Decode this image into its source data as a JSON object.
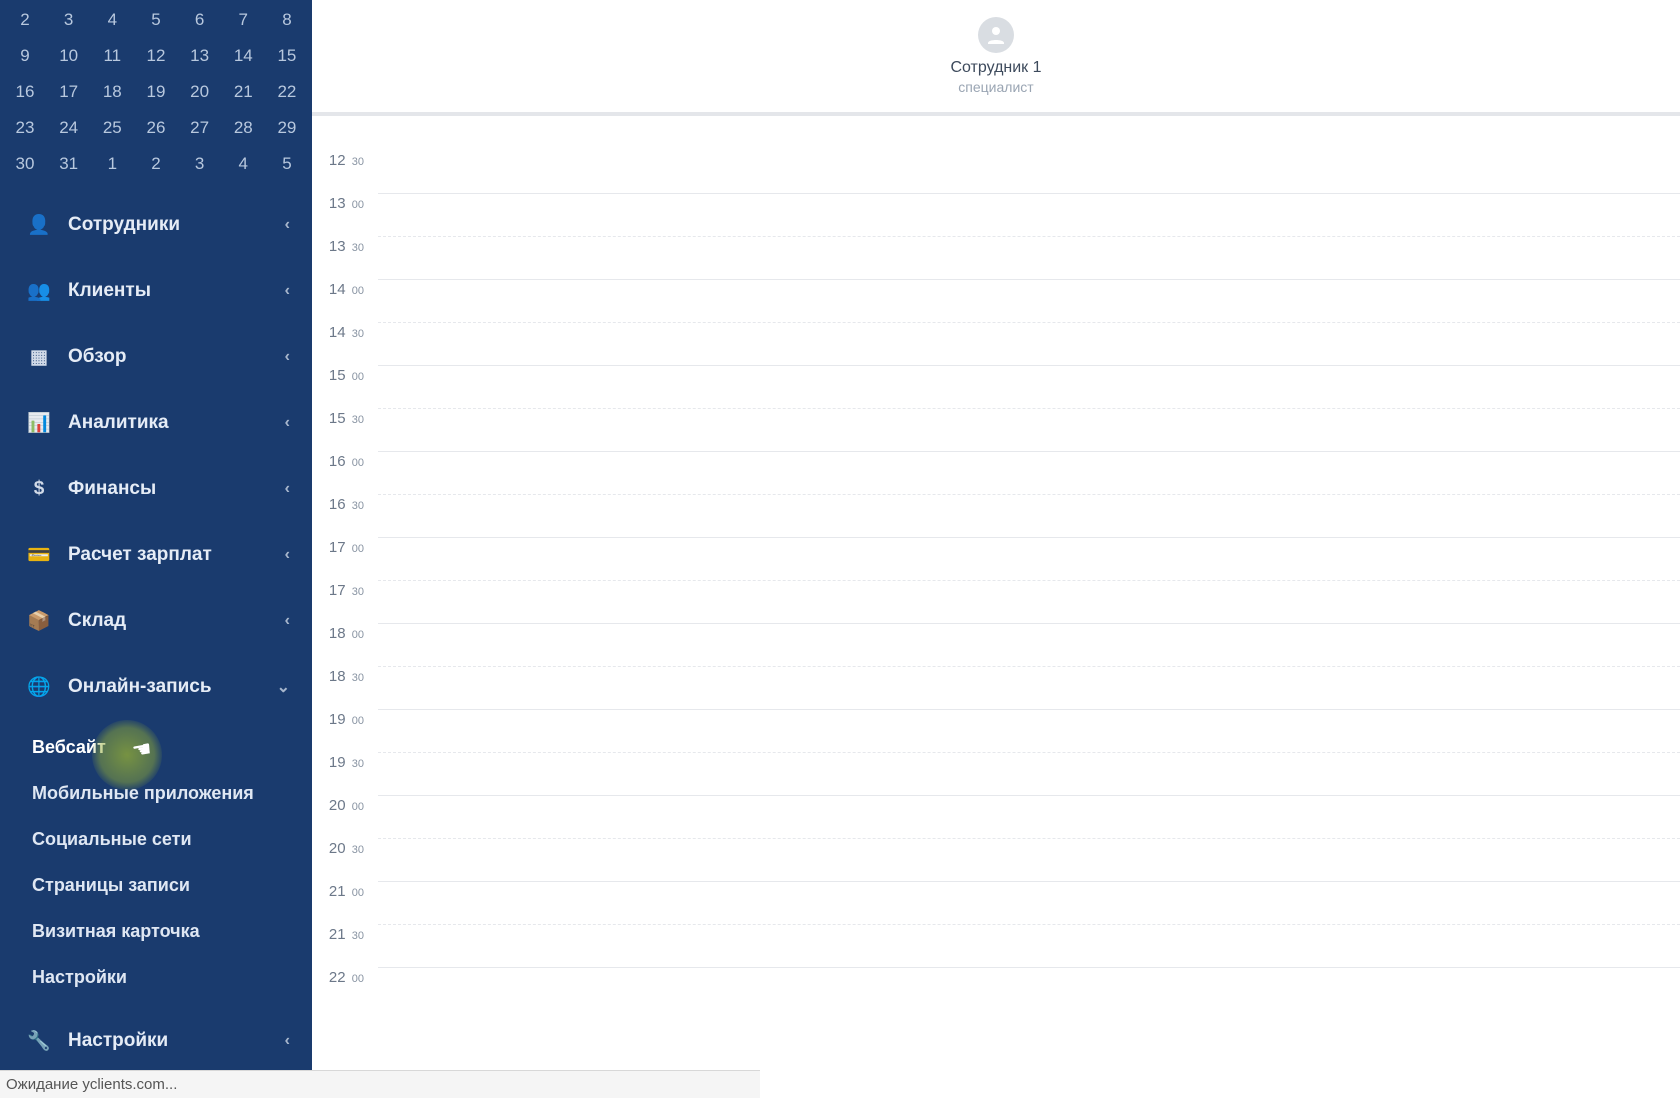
{
  "calendar": {
    "today": "2",
    "rows": [
      [
        "2",
        "3",
        "4",
        "5",
        "6",
        "7",
        "8"
      ],
      [
        "9",
        "10",
        "11",
        "12",
        "13",
        "14",
        "15"
      ],
      [
        "16",
        "17",
        "18",
        "19",
        "20",
        "21",
        "22"
      ],
      [
        "23",
        "24",
        "25",
        "26",
        "27",
        "28",
        "29"
      ],
      [
        "30",
        "31",
        "1",
        "2",
        "3",
        "4",
        "5"
      ]
    ]
  },
  "nav": {
    "items": [
      {
        "icon": "user-icon",
        "label": "Сотрудники"
      },
      {
        "icon": "people-icon",
        "label": "Клиенты"
      },
      {
        "icon": "grid-icon",
        "label": "Обзор"
      },
      {
        "icon": "chart-icon",
        "label": "Аналитика"
      },
      {
        "icon": "dollar-icon",
        "label": "Финансы"
      },
      {
        "icon": "card-icon",
        "label": "Расчет зарплат"
      },
      {
        "icon": "box-icon",
        "label": "Склад"
      },
      {
        "icon": "globe-icon",
        "label": "Онлайн-запись",
        "expanded": true,
        "children": [
          "Вебсайт",
          "Мобильные приложения",
          "Социальные сети",
          "Страницы записи",
          "Визитная карточка",
          "Настройки"
        ]
      },
      {
        "icon": "wrench-icon",
        "label": "Настройки"
      }
    ]
  },
  "staff": {
    "name": "Сотрудник 1",
    "role": "специалист"
  },
  "schedule": {
    "slots": [
      {
        "h": "12",
        "m": "30"
      },
      {
        "h": "13",
        "m": "00"
      },
      {
        "h": "13",
        "m": "30"
      },
      {
        "h": "14",
        "m": "00"
      },
      {
        "h": "14",
        "m": "30"
      },
      {
        "h": "15",
        "m": "00"
      },
      {
        "h": "15",
        "m": "30"
      },
      {
        "h": "16",
        "m": "00"
      },
      {
        "h": "16",
        "m": "30"
      },
      {
        "h": "17",
        "m": "00"
      },
      {
        "h": "17",
        "m": "30"
      },
      {
        "h": "18",
        "m": "00"
      },
      {
        "h": "18",
        "m": "30"
      },
      {
        "h": "19",
        "m": "00"
      },
      {
        "h": "19",
        "m": "30"
      },
      {
        "h": "20",
        "m": "00"
      },
      {
        "h": "20",
        "m": "30"
      },
      {
        "h": "21",
        "m": "00"
      },
      {
        "h": "21",
        "m": "30"
      },
      {
        "h": "22",
        "m": "00"
      }
    ]
  },
  "status_bar": {
    "text": "Ожидание yclients.com..."
  }
}
